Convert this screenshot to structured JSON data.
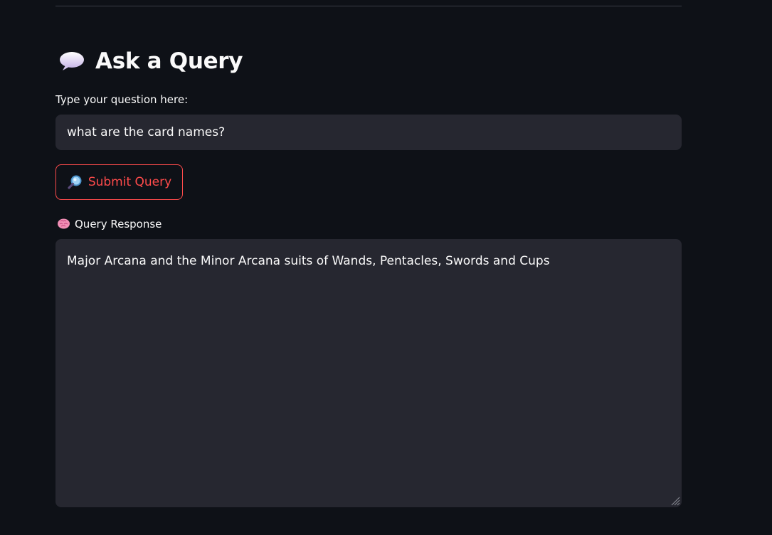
{
  "header": {
    "title": "Ask a Query",
    "icon": "speech-bubble-icon"
  },
  "query": {
    "label": "Type your question here:",
    "value": "what are the card names?"
  },
  "submit": {
    "label": "Submit Query",
    "icon": "magnifier-icon",
    "accent": "#ff4b4b"
  },
  "response": {
    "label": "Query Response",
    "icon": "brain-icon",
    "value": "Major Arcana and the Minor Arcana suits of Wands, Pentacles, Swords and Cups"
  },
  "colors": {
    "background": "#0e1117",
    "field": "#262730",
    "text": "#fafafa"
  }
}
